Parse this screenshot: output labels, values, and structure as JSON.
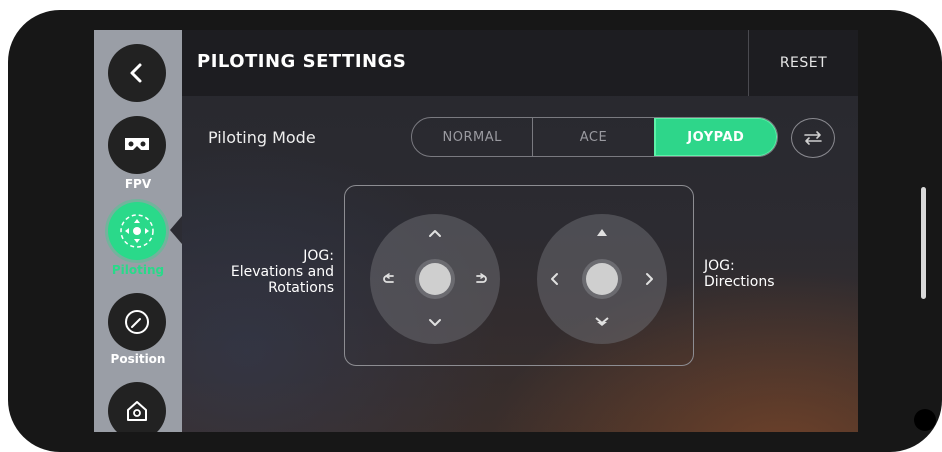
{
  "header": {
    "title": "PILOTING SETTINGS",
    "reset_label": "RESET"
  },
  "sidebar": {
    "items": [
      {
        "icon": "back-chevron-icon",
        "label": ""
      },
      {
        "icon": "vr-headset-icon",
        "label": "FPV"
      },
      {
        "icon": "piloting-icon",
        "label": "Piloting",
        "active": true
      },
      {
        "icon": "compass-icon",
        "label": "Position"
      },
      {
        "icon": "home-icon",
        "label": ""
      }
    ]
  },
  "piloting_mode": {
    "label": "Piloting Mode",
    "options": [
      "NORMAL",
      "ACE",
      "JOYPAD"
    ],
    "selected": "JOYPAD"
  },
  "jog": {
    "left_label_line1": "JOG:",
    "left_label_line2": "Elevations and",
    "left_label_line3": "Rotations",
    "right_label_line1": "JOG:",
    "right_label_line2": "Directions"
  },
  "colors": {
    "accent": "#2ed68a",
    "sidebar_bg": "#9a9ea6",
    "topbar_bg": "#1d1d21"
  }
}
